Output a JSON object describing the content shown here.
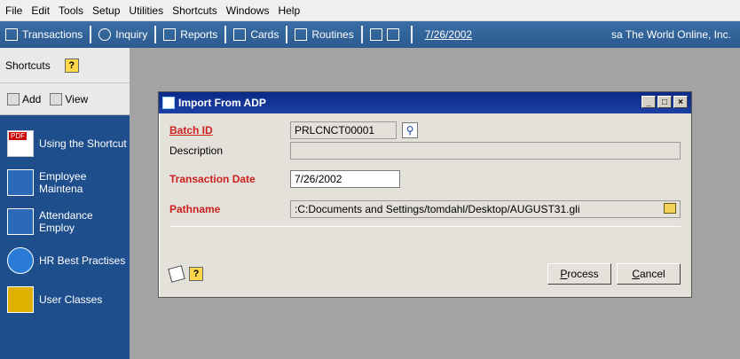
{
  "menu": [
    "File",
    "Edit",
    "Tools",
    "Setup",
    "Utilities",
    "Shortcuts",
    "Windows",
    "Help"
  ],
  "toolbar": {
    "transactions": "Transactions",
    "inquiry": "Inquiry",
    "reports": "Reports",
    "cards": "Cards",
    "routines": "Routines",
    "date": "7/26/2002",
    "company": "sa  The World Online, Inc."
  },
  "shortcuts_panel": {
    "title": "Shortcuts",
    "help_glyph": "?",
    "add_label": "Add",
    "view_label": "View",
    "items": [
      {
        "label": "Using the Shortcut",
        "icon": "pdf-icon"
      },
      {
        "label": "Employee Maintena",
        "icon": "window-icon"
      },
      {
        "label": "Attendance Employ",
        "icon": "window-icon"
      },
      {
        "label": "HR Best Practises",
        "icon": "ie-icon"
      },
      {
        "label": "User Classes",
        "icon": "users-icon"
      }
    ]
  },
  "dialog": {
    "title": "Import From ADP",
    "fields": {
      "batch_id_label": "Batch ID",
      "batch_id_value": "PRLCNCT00001",
      "description_label": "Description",
      "description_value": "",
      "transaction_date_label": "Transaction Date",
      "transaction_date_value": "7/26/2002",
      "pathname_label": "Pathname",
      "pathname_value": ":C:Documents and Settings/tomdahl/Desktop/AUGUST31.gli"
    },
    "buttons": {
      "process_key": "P",
      "process_rest": "rocess",
      "cancel_key": "C",
      "cancel_rest": "ancel"
    }
  }
}
